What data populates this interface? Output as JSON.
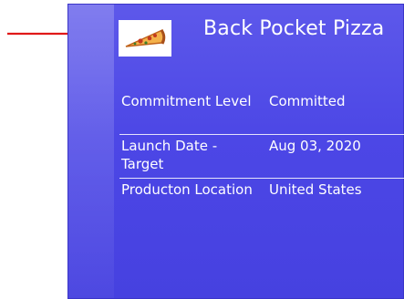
{
  "card": {
    "title": "Back Pocket Pizza",
    "icon": "pizza-slice-icon",
    "background_color": "#4c47e6",
    "fields": [
      {
        "label": "Commitment Level",
        "value": "Committed"
      },
      {
        "label": "Launch Date - Target",
        "value": "Aug 03, 2020"
      },
      {
        "label": "Producton Location",
        "value": "United States"
      }
    ]
  },
  "annotation": {
    "arrow_color": "#e01818",
    "points_to": "pizza-slice-icon"
  }
}
